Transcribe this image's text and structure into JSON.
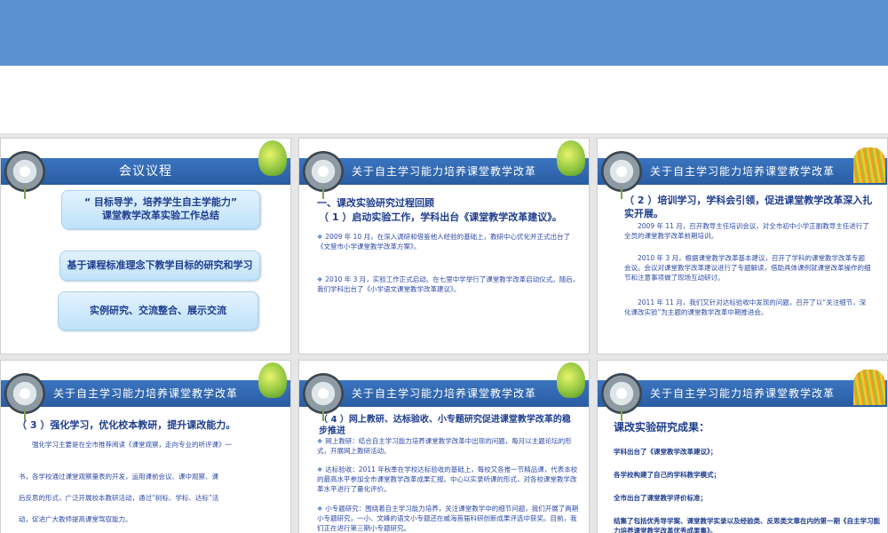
{
  "slides": [
    {
      "title": "会议议程",
      "boxes": [
        "“ 目标导学，培养学生自主学能力”\n课堂教学改革实验工作总结",
        "基于课程标准理念下教学目标的研究和学习",
        "实例研究、交流整合、展示交流"
      ]
    },
    {
      "title": "关于自主学习能力培养课堂教学改革",
      "heading1": "一、课改实验研究过程回顾",
      "heading2": "（ 1 ）启动实验工作，学科出台《课堂教学改革建议》。",
      "paras": [
        "2009 年 10 月，在深入调研和借鉴他人经验的基础上，教研中心优化并正式出台了《文登市小学课堂教学改革方案》。",
        "2010 年 3 月，实验工作正式启动。在七里中学举行了课堂教学改革启动仪式。随后，我们学科出台了《小学语文课堂教学改革建议》。"
      ]
    },
    {
      "title": "关于自主学习能力培养课堂教学改革",
      "heading": "（ 2 ）培训学习，学科会引领，促进课堂教学改革深入扎实开展。",
      "paras": [
        "2009 年 11 月，召开教导主任培训会议，对全市初中小学正副教导主任进行了全员的课堂教学改革前期培训。",
        "2010 年 3 月，根据课堂教学改革基本建议，召开了学科的课堂教学改革专题会议。会议对课堂教学改革建议进行了专题解读，借助具体课例就课堂改革操作的细节和注意事项做了现场互动研讨。",
        "2011 年 11 月，我们又针对达标验收中发现的问题，召开了以“关注细节，深化课改实验”为主题的课堂教学改革中期推进会。"
      ]
    },
    {
      "title": "关于自主学习能力培养课堂教学改革",
      "heading": "（ 3 ）强化学习，优化校本教研，提升课改能力。",
      "paras": [
        "强化学习主要是在全市推荐阅读《课堂观察，走向专业的听评课》一",
        "书，各学校通过课堂观察量表的开发，运用课前会议、课中观察、课",
        "后反思的形式，广泛开展校本教研活动，通过“树标、学标、达标”活",
        "动，促进广大教师提高课堂驾驭能力。"
      ]
    },
    {
      "title": "关于自主学习能力培养课堂教学改革",
      "heading": "（ 4 ）网上教研、达标验收、小专题研究促进课堂教学改革的稳步推进",
      "paras": [
        "网上教研：结合自主学习能力培养课堂教学改革中出现的问题，每月以主题论坛的形式，开展网上教研活动。",
        "达标验收：2011 年秋季在学校达标验收的基础上，每校又各推一节精品课，代表本校的最高水平参加全市课堂教学改革成果汇报。中心以实录听课的形式，对各校课堂教学改革水平进行了量化评价。",
        "小专题研究：围绕着自主学习能力培养，关注课堂教学中的细节问题，我们开展了两期小专题研究，一小、文峰的语文小专题还在威海首届科研创新成果评选中获奖。目前，我们正在进行第三期小专题研究。"
      ]
    },
    {
      "title": "关于自主学习能力培养课堂教学改革",
      "heading": "课改实验研究成果：",
      "items": [
        "学科出台了《课堂教学改革建议》；",
        "各学校构建了自己的学科教学模式；",
        "全市出台了课堂教学评价标准；",
        "结集了包括优秀导学案、课堂教学实录以及经验类、反思类文章在内的第一期《自主学习能力培养课堂教学改革优秀成果集》。"
      ]
    }
  ]
}
